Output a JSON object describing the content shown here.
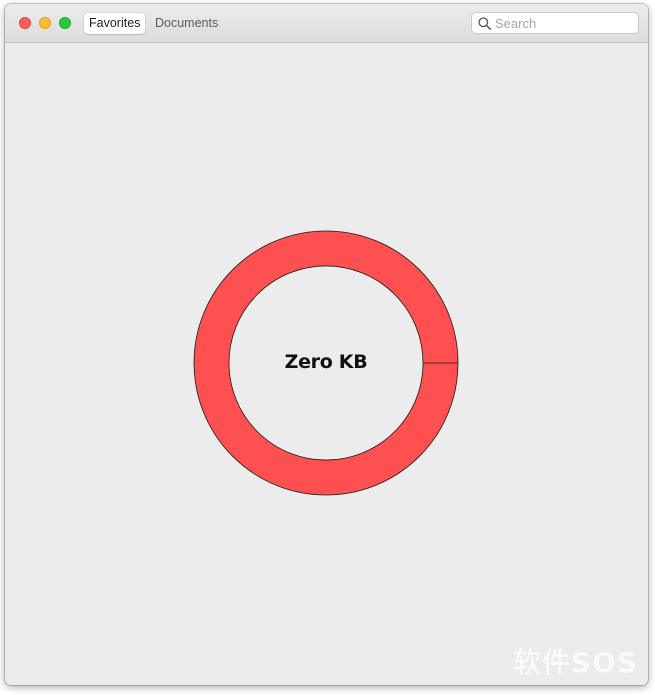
{
  "window": {
    "tabs": [
      {
        "label": "Favorites",
        "active": true
      },
      {
        "label": "Documents",
        "active": false
      }
    ]
  },
  "search": {
    "placeholder": "Search",
    "value": ""
  },
  "usage": {
    "label": "Zero KB",
    "ring_color": "#fe5050",
    "outline_color": "#1a1a1a"
  },
  "watermark": {
    "text": "软件SOS"
  },
  "icons": {
    "search": "magnifier-icon"
  }
}
